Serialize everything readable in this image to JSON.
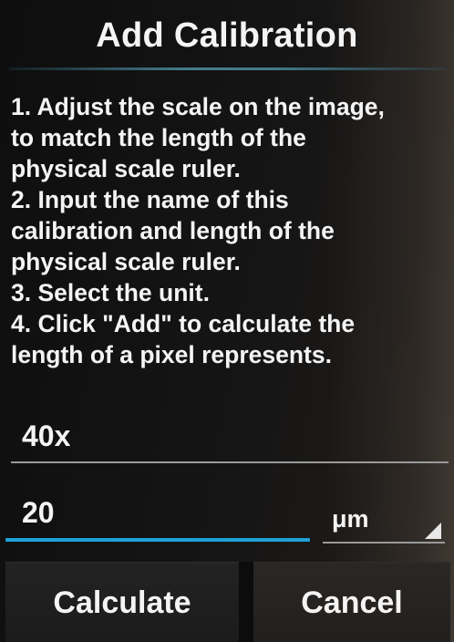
{
  "dialog": {
    "title": "Add Calibration",
    "instructions": [
      "1. Adjust the scale on the image,",
      "to match the length of the",
      "physical scale ruler.",
      " 2. Input the name of this",
      "calibration and length of the",
      "physical scale ruler.",
      " 3. Select the unit.",
      " 4. Click \"Add\" to calculate the",
      "length of a pixel represents."
    ],
    "name_field": {
      "value": "40x"
    },
    "length_field": {
      "value": "20"
    },
    "unit_select": {
      "selected": "μm"
    },
    "buttons": {
      "calculate_label": "Calculate",
      "cancel_label": "Cancel"
    }
  },
  "colors": {
    "accent": "#1fa2d6",
    "text": "#f4f4f4",
    "background": "#0e0e0e"
  }
}
